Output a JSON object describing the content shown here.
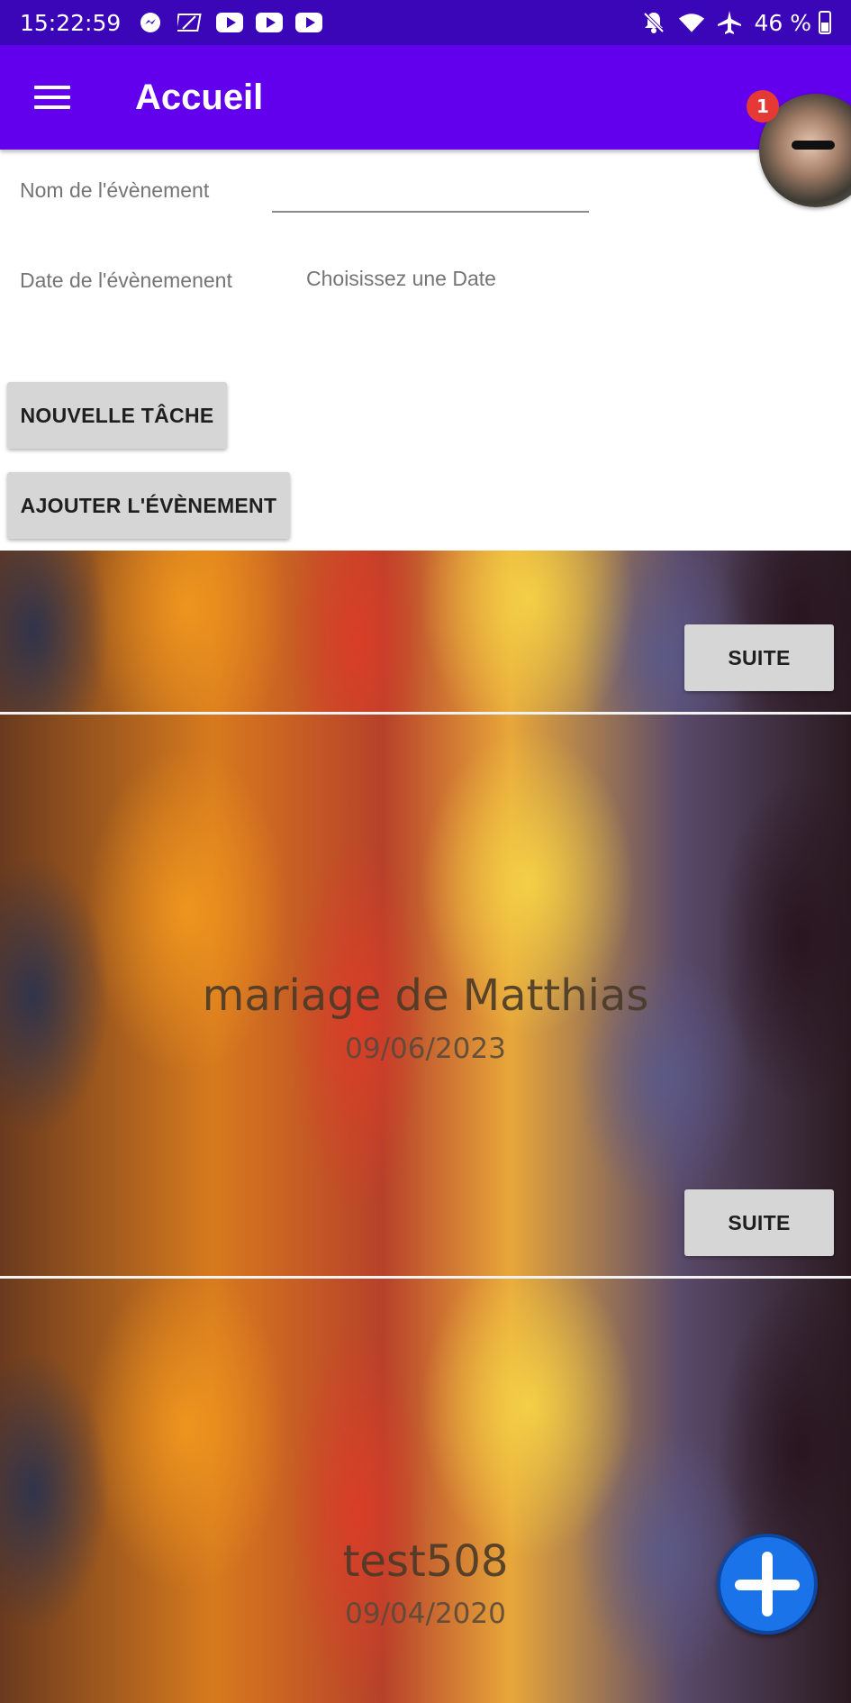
{
  "status_bar": {
    "time": "15:22:59",
    "battery": "46 %",
    "left_icons": [
      "messenger-icon",
      "wallet-icon",
      "youtube-icon",
      "youtube-icon",
      "youtube-icon"
    ],
    "right_icons": [
      "bell-off-icon",
      "wifi-icon",
      "airplane-icon",
      "battery-icon"
    ]
  },
  "app_bar": {
    "title": "Accueil",
    "color": "#6200ee",
    "notification_count": "1"
  },
  "form": {
    "name_label": "Nom de l'évènement",
    "name_value": "",
    "date_label": "Date de l'évènemenent",
    "date_placeholder": "Choisissez une Date"
  },
  "buttons": {
    "new_task": "NOUVELLE TÂCHE",
    "add_event": "AJOUTER L'ÉVÈNEMENT"
  },
  "events": [
    {
      "title": "",
      "date": "",
      "action": "SUITE"
    },
    {
      "title": "mariage de Matthias",
      "date": "09/06/2023",
      "action": "SUITE"
    },
    {
      "title": "test508",
      "date": "09/04/2020",
      "action": ""
    }
  ],
  "fab": {
    "icon": "plus-icon",
    "color": "#1a73e8"
  }
}
